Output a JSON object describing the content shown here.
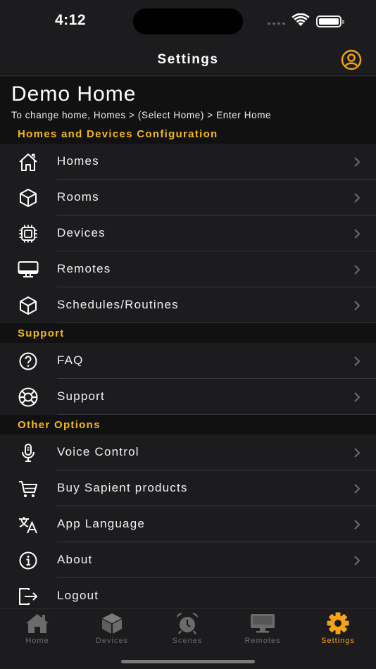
{
  "status_bar": {
    "time": "4:12"
  },
  "nav": {
    "title": "Settings",
    "profile_icon": "person-circle-icon"
  },
  "home": {
    "name": "Demo Home",
    "hint": "To change home, Homes > (Select Home) > Enter Home"
  },
  "sections": {
    "config": {
      "title": "Homes and Devices Configuration"
    },
    "support": {
      "title": "Support"
    },
    "other": {
      "title": "Other Options"
    }
  },
  "config_items": [
    {
      "label": "Homes",
      "icon": "house-icon"
    },
    {
      "label": "Rooms",
      "icon": "cube-icon"
    },
    {
      "label": "Devices",
      "icon": "chip-icon"
    },
    {
      "label": "Remotes",
      "icon": "display-icon"
    },
    {
      "label": "Schedules/Routines",
      "icon": "cube-icon"
    }
  ],
  "support_items": [
    {
      "label": "FAQ",
      "icon": "question-circle-icon"
    },
    {
      "label": "Support",
      "icon": "lifebuoy-icon"
    }
  ],
  "other_items": [
    {
      "label": "Voice Control",
      "icon": "microphone-icon"
    },
    {
      "label": "Buy Sapient products",
      "icon": "cart-icon"
    },
    {
      "label": "App Language",
      "icon": "translate-icon"
    },
    {
      "label": "About",
      "icon": "info-circle-icon"
    },
    {
      "label": "Logout",
      "icon": "logout-icon"
    }
  ],
  "tabs": [
    {
      "label": "Home",
      "icon": "house-fill-icon",
      "active": false
    },
    {
      "label": "Devices",
      "icon": "cube-fill-icon",
      "active": false
    },
    {
      "label": "Scenes",
      "icon": "alarm-clock-icon",
      "active": false
    },
    {
      "label": "Remotes",
      "icon": "tv-icon",
      "active": false
    },
    {
      "label": "Settings",
      "icon": "gear-icon",
      "active": true
    }
  ],
  "colors": {
    "accent": "#f5a213",
    "section_title": "#f5b914",
    "background": "#1c1c1e",
    "inactive_tab": "#6b6b6b"
  }
}
